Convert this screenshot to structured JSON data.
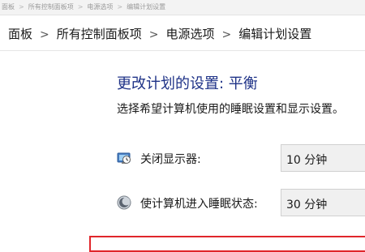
{
  "titlebar": {
    "crumbs": [
      "面板",
      "所有控制面板项",
      "电源选项",
      "编辑计划设置"
    ]
  },
  "breadcrumb": {
    "crumbs": [
      "面板",
      "所有控制面板项",
      "电源选项",
      "编辑计划设置"
    ],
    "separator": ">"
  },
  "main": {
    "title": "更改计划的设置: 平衡",
    "subtitle": "选择希望计算机使用的睡眠设置和显示设置。"
  },
  "settings": {
    "display_off": {
      "label": "关闭显示器:",
      "value": "10 分钟",
      "icon": "monitor-clock-icon"
    },
    "sleep": {
      "label": "使计算机进入睡眠状态:",
      "value": "30 分钟",
      "icon": "moon-icon"
    }
  },
  "colors": {
    "title": "#1e3287",
    "highlight": "#e0262b",
    "select_bg": "#f0f0f0"
  }
}
